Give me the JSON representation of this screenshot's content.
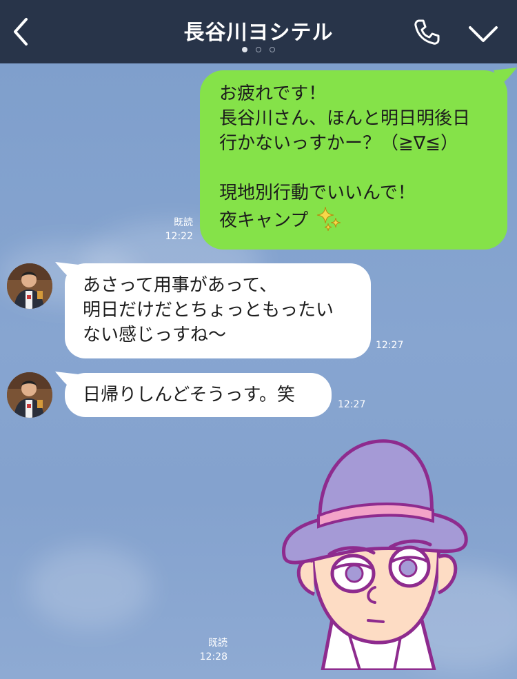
{
  "header": {
    "title": "長谷川ヨシテル",
    "back_icon": "chevron-left-icon",
    "call_icon": "phone-icon",
    "menu_icon": "chevron-down-icon",
    "page_dots": 3,
    "active_dot": 1,
    "bg_color": "#283449"
  },
  "messages": [
    {
      "side": "outgoing",
      "lines": [
        "お疲れです！",
        "長谷川さん、ほんと明日明後日",
        "行かないっすかー？（≧∇≦）",
        "",
        "現地別行動でいいんで！",
        "夜キャンプ"
      ],
      "emoji": "sparkles-icon",
      "read": "既読",
      "time": "12:22",
      "bubble_color": "#85e249"
    },
    {
      "side": "incoming",
      "lines": [
        "あさって用事があって、",
        "明日だけだとちょっともったい",
        "ない感じっすね〜"
      ],
      "time": "12:27",
      "avatar": "contact-avatar"
    },
    {
      "side": "incoming",
      "lines": [
        "日帰りしんどそうっす。笑"
      ],
      "time": "12:27",
      "avatar": "contact-avatar"
    },
    {
      "side": "outgoing",
      "type": "sticker",
      "sticker": "man-in-purple-hat-sticker",
      "read": "既読",
      "time": "12:28"
    }
  ]
}
